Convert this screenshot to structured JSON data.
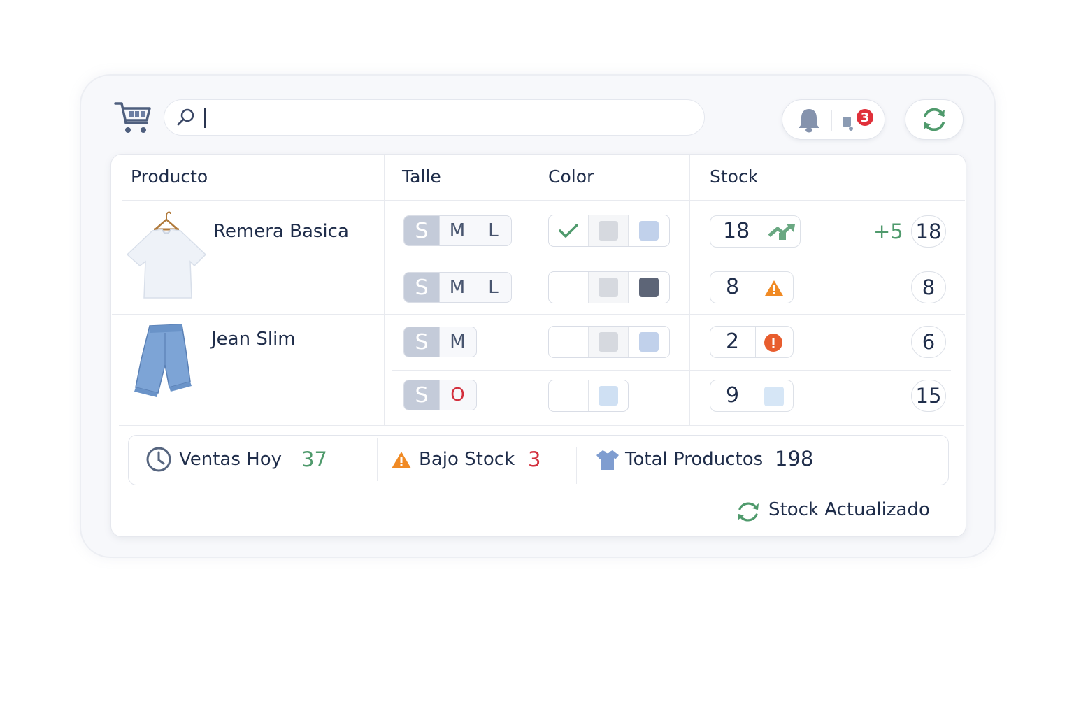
{
  "search": {
    "placeholder": "",
    "value": ""
  },
  "notifications": {
    "badge_count": "3"
  },
  "table": {
    "columns": [
      "Producto",
      "Talle",
      "Color",
      "Stock"
    ],
    "products": [
      {
        "name": "Remera Basica",
        "image_icon": "tshirt-image",
        "variants": [
          {
            "sizes": [
              "S",
              "M",
              "L"
            ],
            "selected_size": "S",
            "colors": [
              "check",
              "#d6d9df",
              "#c1d1eb"
            ],
            "stock": "18",
            "status_icon": "trend-up-icon",
            "delta": "+5",
            "total": "18"
          },
          {
            "sizes": [
              "S",
              "M",
              "L"
            ],
            "selected_size": "S",
            "colors": [
              "empty",
              "#d6d9df",
              "#5d6577"
            ],
            "stock": "8",
            "status_icon": "warning-icon",
            "total": "8"
          }
        ]
      },
      {
        "name": "Jean Slim",
        "image_icon": "jeans-image",
        "variants": [
          {
            "sizes": [
              "S",
              "M"
            ],
            "selected_size": "S",
            "colors": [
              "empty",
              "#d6d9df",
              "#c1d1eb"
            ],
            "stock": "2",
            "status_icon": "alert-circle-icon",
            "total": "6"
          },
          {
            "sizes": [
              "S",
              "O"
            ],
            "selected_size": "S",
            "colors": [
              "empty",
              "#cfe0f3"
            ],
            "stock": "9",
            "status_icon": "color-square",
            "total": "15"
          }
        ]
      }
    ]
  },
  "summary": {
    "sales_label": "Ventas Hoy",
    "sales_value": "37",
    "low_stock_label": "Bajo Stock",
    "low_stock_value": "3",
    "total_label": "Total Productos",
    "total_value": "198"
  },
  "status": {
    "updated_label": "Stock Actualizado"
  },
  "colors": {
    "accent_green": "#4f9a6c",
    "alert_red": "#d32f3d",
    "warning_orange": "#f08a24",
    "text_navy": "#1f2d4a"
  }
}
